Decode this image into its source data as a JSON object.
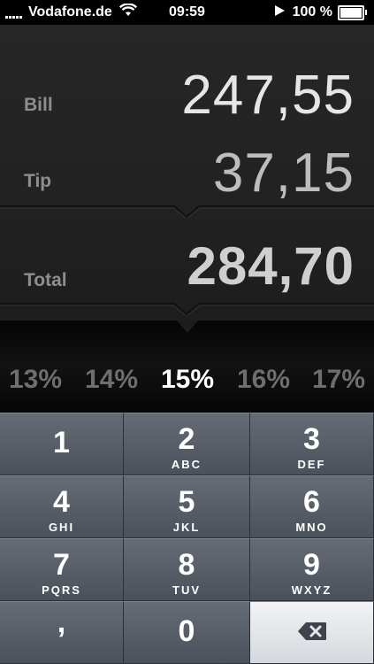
{
  "status_bar": {
    "carrier": "Vodafone.de",
    "time": "09:59",
    "battery": "100 %"
  },
  "display": {
    "bill": {
      "label": "Bill",
      "value": "247,55"
    },
    "tip": {
      "label": "Tip",
      "value": "37,15"
    },
    "total": {
      "label": "Total",
      "value": "284,70"
    }
  },
  "percentages": {
    "items": [
      "13%",
      "14%",
      "15%",
      "16%",
      "17%"
    ],
    "selected": "15%"
  },
  "keypad": {
    "keys": [
      {
        "digit": "1",
        "letters": ""
      },
      {
        "digit": "2",
        "letters": "ABC"
      },
      {
        "digit": "3",
        "letters": "DEF"
      },
      {
        "digit": "4",
        "letters": "GHI"
      },
      {
        "digit": "5",
        "letters": "JKL"
      },
      {
        "digit": "6",
        "letters": "MNO"
      },
      {
        "digit": "7",
        "letters": "PQRS"
      },
      {
        "digit": "8",
        "letters": "TUV"
      },
      {
        "digit": "9",
        "letters": "WXYZ"
      }
    ],
    "comma": ",",
    "zero": "0"
  },
  "icons": {
    "signal": "signal-strength-icon",
    "wifi": "wifi-icon",
    "location": "location-arrow-icon",
    "battery": "battery-icon",
    "delete": "backspace-icon"
  },
  "colors": {
    "background": "#232323",
    "bill_value": "#e6e6e6",
    "tip_value": "#bdbdbd",
    "label": "#8e8e8e",
    "selected_percent": "#ffffff",
    "unselected_percent": "#6e6e6e",
    "key": "#5a606a",
    "delete_key": "#e4e6ea"
  }
}
